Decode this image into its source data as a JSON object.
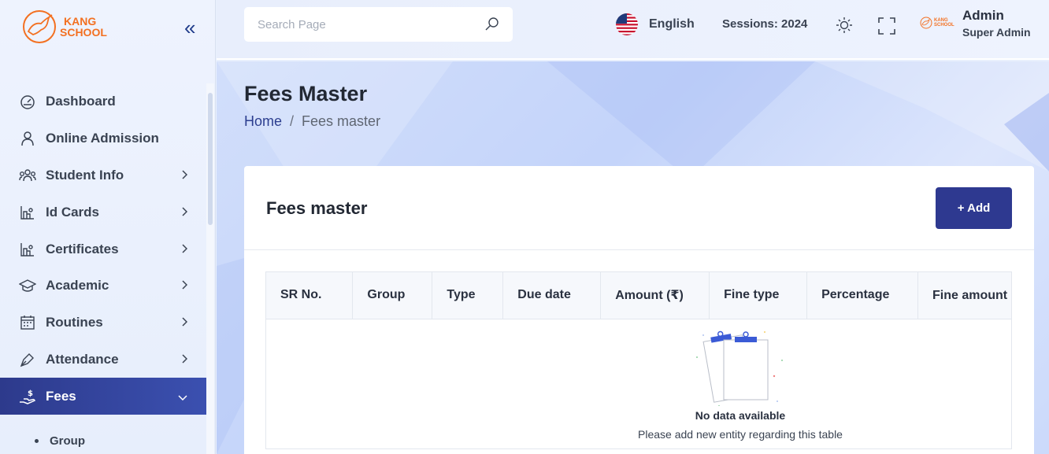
{
  "brand": {
    "line1": "KANG",
    "line2": "SCHOOL"
  },
  "sidebar": {
    "items": [
      {
        "label": "Dashboard",
        "icon": "dashboard-icon",
        "has_chevron": false
      },
      {
        "label": "Online Admission",
        "icon": "user-icon",
        "has_chevron": false
      },
      {
        "label": "Student Info",
        "icon": "users-icon",
        "has_chevron": true
      },
      {
        "label": "Id Cards",
        "icon": "id-card-icon",
        "has_chevron": true
      },
      {
        "label": "Certificates",
        "icon": "certificate-icon",
        "has_chevron": true
      },
      {
        "label": "Academic",
        "icon": "graduation-cap-icon",
        "has_chevron": true
      },
      {
        "label": "Routines",
        "icon": "calendar-icon",
        "has_chevron": true
      },
      {
        "label": "Attendance",
        "icon": "pen-icon",
        "has_chevron": true
      },
      {
        "label": "Fees",
        "icon": "money-hand-icon",
        "has_chevron": true,
        "active": true
      }
    ],
    "sub_items": [
      {
        "label": "Group"
      }
    ]
  },
  "header": {
    "search_placeholder": "Search Page",
    "language": "English",
    "session": "Sessions: 2024",
    "user_name": "Admin",
    "user_role": "Super Admin"
  },
  "page": {
    "title": "Fees Master",
    "breadcrumb_home": "Home",
    "breadcrumb_sep": "/",
    "breadcrumb_current": "Fees master"
  },
  "card": {
    "title": "Fees master",
    "add_label": "+ Add",
    "columns": [
      "SR No.",
      "Group",
      "Type",
      "Due date",
      "Amount (₹)",
      "Fine type",
      "Percentage",
      "Fine amount (₹)"
    ],
    "empty_title": "No data available",
    "empty_subtitle": "Please add new entity regarding this table"
  },
  "colors": {
    "accent": "#2e3990",
    "brand_orange": "#f37021"
  }
}
